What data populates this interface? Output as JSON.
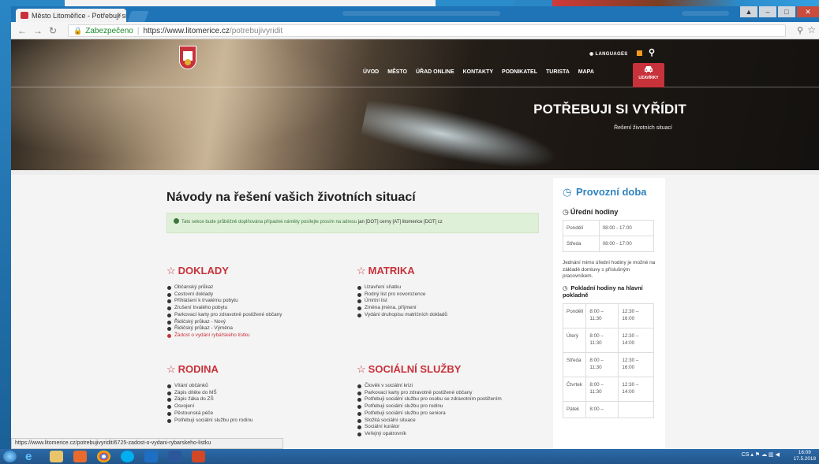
{
  "browser": {
    "tab_title": "Město Litoměřice - Potřebuji si vyřídit",
    "tab_close": "×",
    "security_label": "Zabezpečeno",
    "url_base": "https://www.litomerice.cz",
    "url_path": "/potrebujivyridit",
    "status_url": "https://www.litomerice.cz/potrebujivyridit/6725-zadost-o-vydani-rybarskeho-listku"
  },
  "header": {
    "languages": "LANGUAGES",
    "nav": [
      "ÚVOD",
      "MĚSTO",
      "ÚŘAD ONLINE",
      "KONTAKTY",
      "PODNIKATEL",
      "TURISTA",
      "MAPA"
    ],
    "closures": "UZAVÍRKY",
    "hero_title": "POTŘEBUJI SI VYŘÍDIT",
    "hero_subtitle": "Řešení životních situací"
  },
  "main": {
    "heading": "Návody na řešení vašich životních situací",
    "notice": "Tato sekce bude průběžně doplňována případné náměty posílejte prosím na adresu",
    "notice_email": "jan [DOT] cerny [AT] litomerice [DOT] cz"
  },
  "categories": {
    "doklady": {
      "title": "DOKLADY",
      "items": [
        "Občanský průkaz",
        "Cestovní doklady",
        "Přihlášení k trvalému pobytu",
        "Zrušení trvalého pobytu",
        "Parkovací karty pro zdravotně postižené občany",
        "Řidičský průkaz - Nový",
        "Řidičský průkaz - Výměna",
        "Žádost o vydání rybářského lístku"
      ]
    },
    "matrika": {
      "title": "MATRIKA",
      "items": [
        "Uzavření sňatku",
        "Rodný list pro novorozence",
        "Úmrtní list",
        "Změna jména, příjmení",
        "Vydání druhopisu matričních dokladů"
      ]
    },
    "rodina": {
      "title": "RODINA",
      "items": [
        "Vítání občánků",
        "Zápis dítěte do MŠ",
        "Zápis žáka do ZŠ",
        "Osvojení",
        "Pěstounská péče",
        "Potřebuji sociální službu pro rodinu"
      ]
    },
    "socialni": {
      "title": "SOCIÁLNÍ SLUŽBY",
      "items": [
        "Člověk v sociální krizi",
        "Parkovací karty pro zdravotně postižené občany",
        "Potřebuji sociální službu pro osobu se zdravotním postižením",
        "Potřebuji sociální službu pro rodinu",
        "Potřebuji sociální službu pro seniora",
        "Složitá sociální situace",
        "Sociální kurátor",
        "Veřejný opatrovník"
      ]
    }
  },
  "sidebar": {
    "title": "Provozní doba",
    "office_hours_title": "Úřední hodiny",
    "office_hours": [
      {
        "day": "Pondělí",
        "time": "08:00 - 17:00"
      },
      {
        "day": "Středa",
        "time": "08:00 - 17:00"
      }
    ],
    "note": "Jednání mimo úřední hodiny je možné na základě domluvy s příslušným pracovníkem.",
    "cashier_title": "Pokladní hodiny na hlavní pokladně",
    "cashier_hours": [
      {
        "day": "Pondělí",
        "am": "8:00 – 11:30",
        "pm": "12:30 – 16:00"
      },
      {
        "day": "Úterý",
        "am": "8:00 – 11:30",
        "pm": "12:30 – 14:00"
      },
      {
        "day": "Středa",
        "am": "8:00 – 11:30",
        "pm": "12:30 – 16:00"
      },
      {
        "day": "Čtvrtek",
        "am": "8:00 – 11:30",
        "pm": "12:30 – 14:00"
      },
      {
        "day": "Pátek",
        "am": "8:00 –",
        "pm": ""
      }
    ]
  },
  "taskbar": {
    "lang": "CS",
    "time": "16:09",
    "date": "17.5.2018"
  }
}
